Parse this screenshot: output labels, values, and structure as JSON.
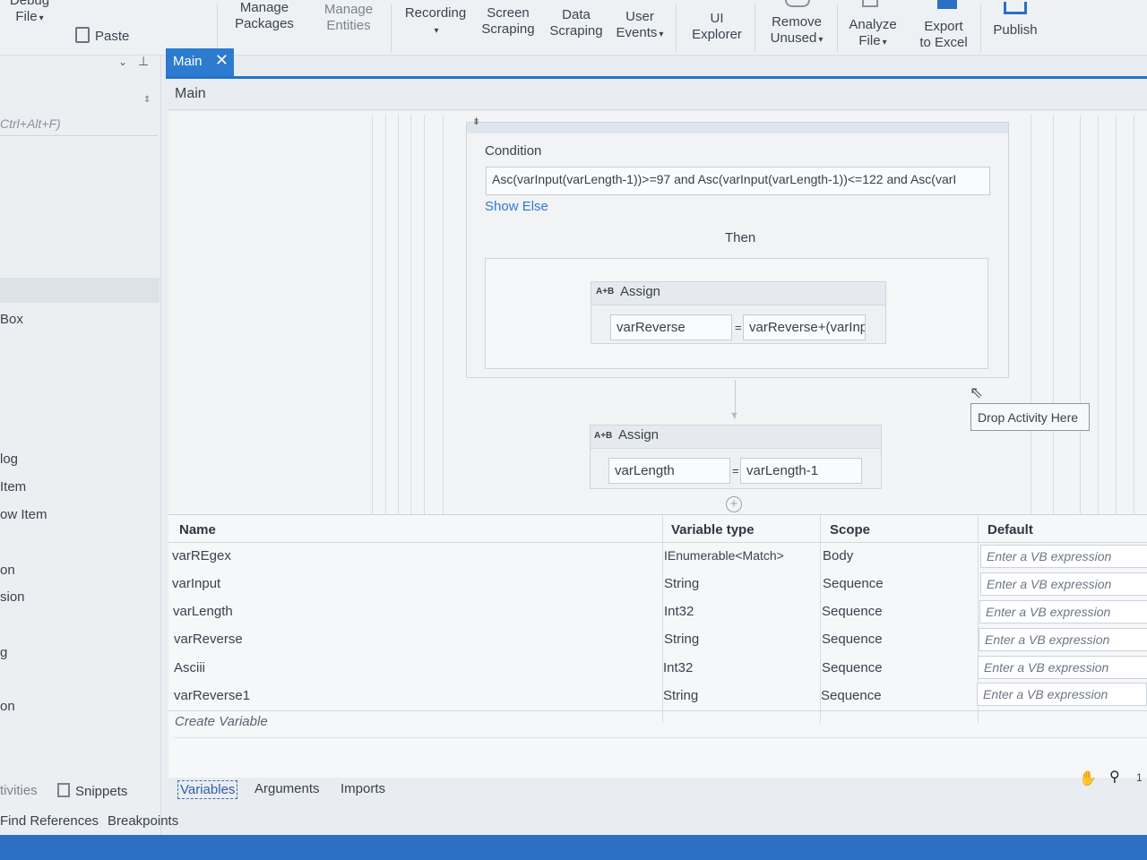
{
  "ribbon": {
    "debug_file": "Debug\nFile",
    "paste": "Paste",
    "manage_packages": "Manage\nPackages",
    "manage_entities": "Manage\nEntities",
    "recording": "Recording",
    "screen_scraping": "Screen\nScraping",
    "data_scraping": "Data\nScraping",
    "user_events": "User\nEvents",
    "ui_explorer": "UI\nExplorer",
    "remove_unused": "Remove\nUnused",
    "analyze_file": "Analyze\nFile",
    "export_to_excel": "Export\nto Excel",
    "publish": "Publish"
  },
  "left_panel": {
    "search_hint": "Ctrl+Alt+F)",
    "items": [
      "Box",
      "log",
      "Item",
      "ow Item",
      "on",
      "sion",
      "g",
      "on"
    ],
    "bottom_tabs": [
      "tivities",
      "Snippets"
    ],
    "bottom_tabs2": [
      "Find References",
      "Breakpoints"
    ]
  },
  "tabs": {
    "main_tab": "Main",
    "breadcrumb": "Main"
  },
  "designer": {
    "condition_label": "Condition",
    "condition_value": "Asc(varInput(varLength-1))>=97 and Asc(varInput(varLength-1))<=122 and Asc(varI",
    "show_else": "Show Else",
    "then_label": "Then",
    "assign1": {
      "title": "Assign",
      "to": "varReverse",
      "value": "varReverse+(varInp"
    },
    "assign2": {
      "title": "Assign",
      "to": "varLength",
      "value": "varLength-1"
    },
    "drop_hint": "Drop Activity Here",
    "assign_icon": "A+B"
  },
  "variables": {
    "headers": {
      "name": "Name",
      "type": "Variable type",
      "scope": "Scope",
      "default": "Default"
    },
    "rows": [
      {
        "name": "varREgex",
        "type": "IEnumerable<Match>",
        "scope": "Body",
        "default": "Enter a VB expression"
      },
      {
        "name": "varInput",
        "type": "String",
        "scope": "Sequence",
        "default": "Enter a VB expression"
      },
      {
        "name": "varLength",
        "type": "Int32",
        "scope": "Sequence",
        "default": "Enter a VB expression"
      },
      {
        "name": "varReverse",
        "type": "String",
        "scope": "Sequence",
        "default": "Enter a VB expression"
      },
      {
        "name": "Asciii",
        "type": "Int32",
        "scope": "Sequence",
        "default": "Enter a VB expression"
      },
      {
        "name": "varReverse1",
        "type": "String",
        "scope": "Sequence",
        "default": "Enter a VB expression"
      }
    ],
    "create_variable": "Create Variable"
  },
  "bottom_tabs": {
    "variables": "Variables",
    "arguments": "Arguments",
    "imports": "Imports"
  },
  "status": {
    "zoom_hint": "1"
  }
}
